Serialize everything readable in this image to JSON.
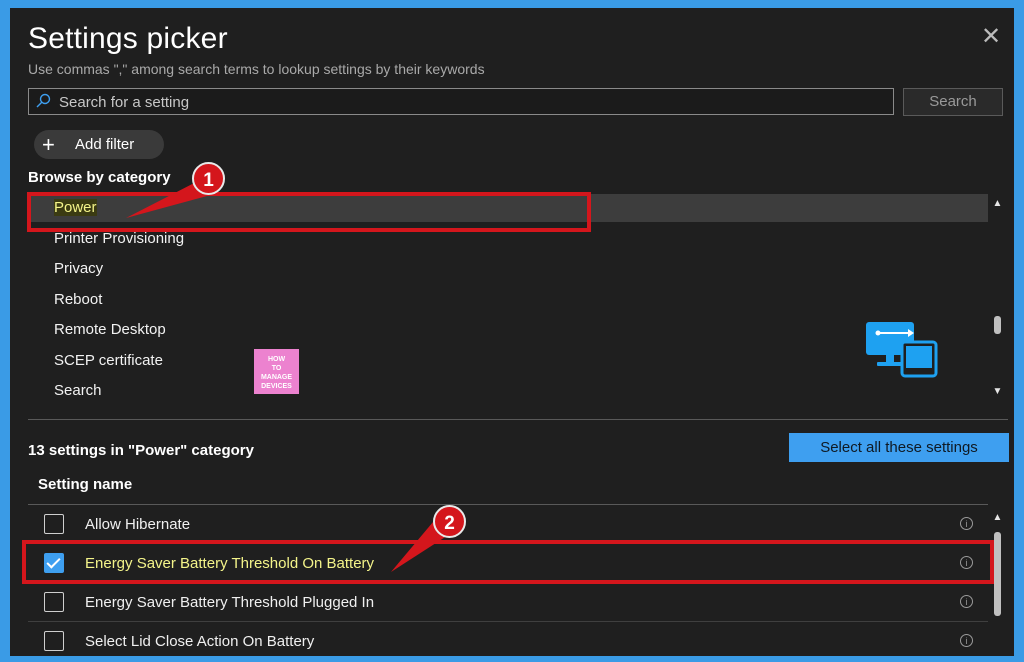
{
  "dialog": {
    "title": "Settings picker",
    "subtitle": "Use commas \",\" among search terms to lookup settings by their keywords",
    "close_icon": "close-icon"
  },
  "search": {
    "placeholder": "Search for a setting",
    "value": "",
    "button_label": "Search"
  },
  "filter": {
    "add_label": "Add filter"
  },
  "browse": {
    "label": "Browse by category",
    "categories": [
      {
        "label": "Power",
        "selected": true
      },
      {
        "label": "Printer Provisioning",
        "selected": false
      },
      {
        "label": "Privacy",
        "selected": false
      },
      {
        "label": "Reboot",
        "selected": false
      },
      {
        "label": "Remote Desktop",
        "selected": false
      },
      {
        "label": "SCEP certificate",
        "selected": false
      },
      {
        "label": "Search",
        "selected": false
      }
    ]
  },
  "results": {
    "count_text": "13 settings in \"Power\" category",
    "select_all_label": "Select all these settings",
    "column_header": "Setting name",
    "rows": [
      {
        "name": "Allow Hibernate",
        "checked": false
      },
      {
        "name": "Energy Saver Battery Threshold On Battery",
        "checked": true
      },
      {
        "name": "Energy Saver Battery Threshold Plugged In",
        "checked": false
      },
      {
        "name": "Select Lid Close Action On Battery",
        "checked": false
      }
    ]
  },
  "annotations": {
    "callout_1": "1",
    "callout_2": "2",
    "logo_text": [
      "HOW",
      "TO",
      "MANAGE",
      "DEVICES"
    ]
  },
  "colors": {
    "background": "#1f1f1f",
    "accent": "#3e9ff0",
    "highlight_text": "#f4f48a",
    "annotation_red": "#d4161c",
    "frame": "#3a9be6"
  }
}
